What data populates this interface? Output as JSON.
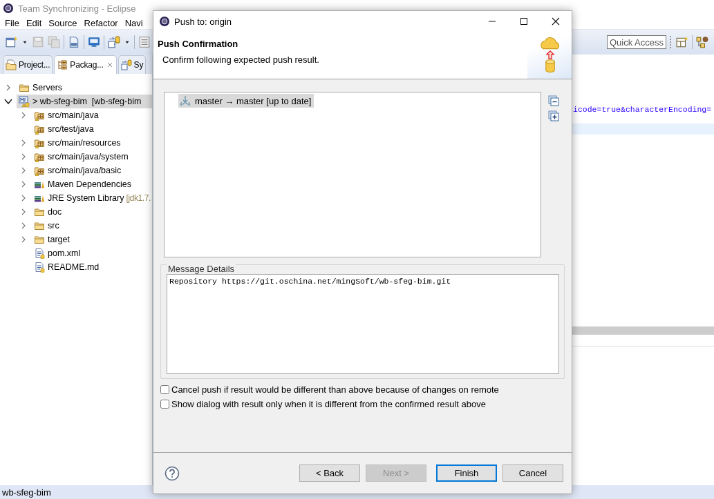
{
  "app": {
    "title": "Team Synchronizing - Eclipse",
    "menu": [
      "File",
      "Edit",
      "Source",
      "Refactor",
      "Navi"
    ]
  },
  "toolbar": {
    "quick_access": {
      "placeholder": "Quick Access"
    }
  },
  "view_tabs": [
    {
      "label": "Project...",
      "kind": "folder",
      "selected": false
    },
    {
      "label": "Packag...",
      "kind": "package",
      "selected": true
    },
    {
      "label": "Sy",
      "kind": "sync",
      "selected": false
    }
  ],
  "tree": [
    {
      "label": "Servers",
      "kind": "folder",
      "expandable": true,
      "expanded": false,
      "selected": false
    },
    {
      "label": "> wb-sfeg-bim  [wb-sfeg-bim",
      "kind": "project",
      "expandable": true,
      "expanded": true,
      "selected": true,
      "children": [
        {
          "label": "src/main/java",
          "kind": "package",
          "expandable": true,
          "expanded": false,
          "selected": false
        },
        {
          "label": "src/test/java",
          "kind": "package",
          "expandable": false,
          "expanded": false,
          "selected": false
        },
        {
          "label": "src/main/resources",
          "kind": "package",
          "expandable": true,
          "expanded": false,
          "selected": false
        },
        {
          "label": "src/main/java/system",
          "kind": "package",
          "expandable": true,
          "expanded": false,
          "selected": false
        },
        {
          "label": "src/main/java/basic",
          "kind": "package",
          "expandable": true,
          "expanded": false,
          "selected": false
        },
        {
          "label": "Maven Dependencies",
          "kind": "library",
          "expandable": true,
          "expanded": false,
          "selected": false
        },
        {
          "label": "JRE System Library",
          "decoration": "[jdk1.7.",
          "kind": "library",
          "expandable": true,
          "expanded": false,
          "selected": false
        },
        {
          "label": "doc",
          "kind": "folder",
          "expandable": true,
          "expanded": false,
          "selected": false
        },
        {
          "label": "src",
          "kind": "folder",
          "expandable": true,
          "expanded": false,
          "selected": false
        },
        {
          "label": "target",
          "kind": "folder",
          "expandable": true,
          "expanded": false,
          "selected": false
        },
        {
          "label": "pom.xml",
          "kind": "file",
          "expandable": false,
          "expanded": false,
          "selected": false
        },
        {
          "label": "README.md",
          "kind": "file",
          "expandable": false,
          "expanded": false,
          "selected": false
        }
      ]
    }
  ],
  "editor": {
    "lines": [
      "icode=true&characterEncoding="
    ]
  },
  "status_bar": {
    "text": "wb-sfeg-bim"
  },
  "dialog": {
    "title": "Push to: origin",
    "heading": "Push Confirmation",
    "description": "Confirm following expected push result.",
    "results": [
      {
        "text": "master → master [up to date]",
        "selected": true
      }
    ],
    "message_details": {
      "label": "Message Details",
      "value": "Repository https://git.oschina.net/mingSoft/wb-sfeg-bim.git"
    },
    "options": [
      {
        "label": "Cancel push if result would be different than above because of changes on remote",
        "checked": false
      },
      {
        "label": "Show dialog with result only when it is different from the confirmed result above",
        "checked": false
      }
    ],
    "buttons": [
      {
        "label": "< Back",
        "disabled": false,
        "default": false
      },
      {
        "label": "Next >",
        "disabled": true,
        "default": false
      },
      {
        "label": "Finish",
        "disabled": false,
        "default": true
      },
      {
        "label": "Cancel",
        "disabled": false,
        "default": false
      }
    ]
  }
}
